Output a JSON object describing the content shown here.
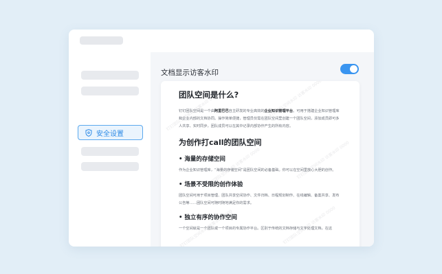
{
  "sidebar": {
    "active_item": {
      "label": "安全设置",
      "icon": "shield-icon",
      "accent": "#2f8be6"
    }
  },
  "setting": {
    "label": "文档显示访客水印",
    "toggle_on": true,
    "toggle_color": "#3a95f0"
  },
  "document": {
    "title": "团队空间是什么?",
    "intro_part1": "钉钉团队空间是一个由",
    "intro_bold1": "阿里巴巴",
    "intro_part2": "自主研发的专业高效的",
    "intro_bold2": "企业知识管理平台",
    "intro_part3": "。可用于搭建企业知识管理库和企业内部的文档协同。操作简单便捷，管理员仅需在团队空间里创建一个团队空间，添加成员即可多人共享、实时同步，团队成员可以在其中记录内部协作产生的所有内容。",
    "section_title": "为创作打call的团队空间",
    "features": [
      {
        "title": "• 海量的存储空间",
        "desc": "作为企业知识管理库，“海量的存储空间”是团队空间的必备基础。你可以在空间里放心大胆的创作。"
      },
      {
        "title": "• 场景不受限的创作体验",
        "desc": "团队空间可用于项目管理、团队共享空间协作、文件归档、日程规划制作、在线编辑、备案共享、发布公告等……团队空间可随时随地满足你的需求。"
      },
      {
        "title": "• 独立有序的协作空间",
        "desc": "一个空间就是一个团队或一个项目的专属协作平台。区别于传统的文档存储与文字处理文档，在这"
      }
    ],
    "watermark_text": "钉钉团队空间水印 访客水印 0000"
  }
}
